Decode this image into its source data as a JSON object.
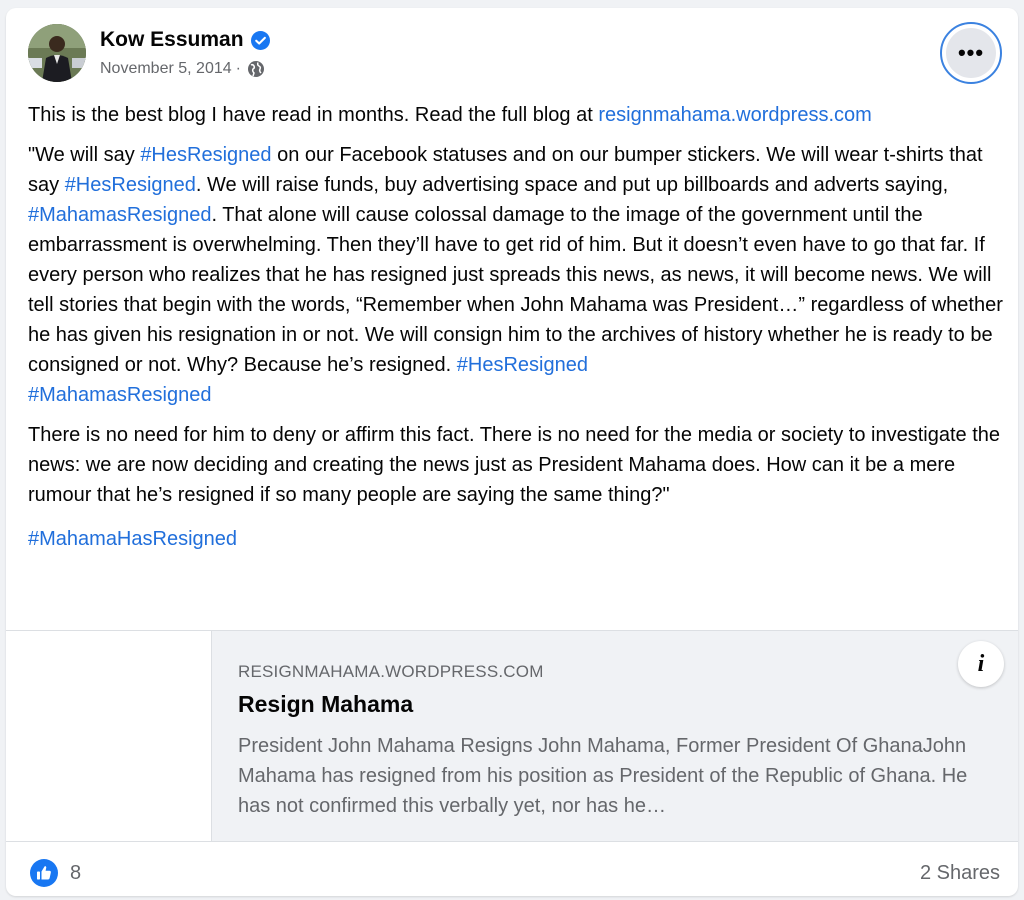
{
  "post": {
    "author": "Kow Essuman",
    "date": "November 5, 2014",
    "separator": "·",
    "intro_text": "This is the best blog I have read in months. Read the full blog at ",
    "intro_link": "resignmahama.wordpress.com",
    "quote": {
      "t1": "\"We will say ",
      "h1": "#HesResigned",
      "t2": " on our Facebook statuses and on our bumper stickers. We will wear t-shirts that say ",
      "h2": "#HesResigned",
      "t3": ". We will raise funds, buy advertising space and put up billboards and adverts saying, ",
      "h3": "#MahamasResigned",
      "t4": ". That alone will cause colossal damage to the image of the government until the embarrassment is overwhelming. Then they’ll have to get rid of him. But it doesn’t even have to go that far. If every person who realizes that he has resigned just spreads this news, as news, it will become news. We will tell stories that begin with the words, “Remember when John Mahama was President…” regardless of whether he has given his resignation in or not. We will consign him to the archives of history whether he is ready to be consigned or not. Why? Because he’s resigned. ",
      "h4": "#HesResigned",
      "h5": "#MahamasResigned"
    },
    "para3": "There is no need for him to deny or affirm this fact. There is no need for the media or society to investigate the news: we are now deciding and creating the news just as President Mahama does. How can it be a mere rumour that he’s resigned if so many people are saying the same thing?\"",
    "final_hashtag": "#MahamaHasResigned"
  },
  "preview": {
    "domain": "RESIGNMAHAMA.WORDPRESS.COM",
    "title": "Resign Mahama",
    "description": "President John Mahama Resigns John Mahama, Former President Of GhanaJohn Mahama has resigned from his position as President of the Republic of Ghana. He has not confirmed this verbally yet, nor has he…",
    "info_glyph": "i"
  },
  "footer": {
    "like_count": "8",
    "shares": "2 Shares"
  },
  "colors": {
    "link": "#216fdb",
    "verified": "#1877f2",
    "like": "#1877f2"
  }
}
